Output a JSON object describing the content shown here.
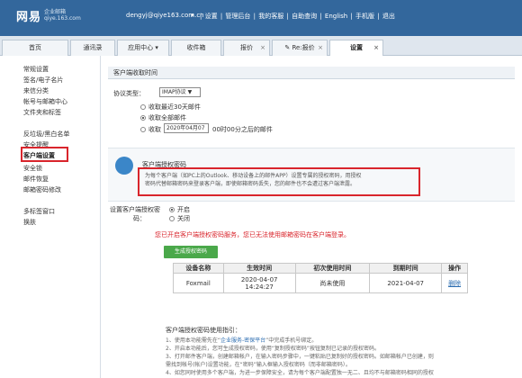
{
  "header": {
    "logo": "网易",
    "logo_sub_line1": "企业邮箱",
    "logo_sub_line2": "qiye.163.com",
    "account": "dengyj@qiye163.com.cn",
    "account_caret": "▾",
    "nav": [
      "设置",
      "管理后台",
      "我的客服",
      "自助查询",
      "English",
      "手机版",
      "退出"
    ]
  },
  "tabs": [
    {
      "label": "首页"
    },
    {
      "label": "通讯录"
    },
    {
      "label": "应用中心",
      "suffix": "▾"
    },
    {
      "label": "收件箱"
    },
    {
      "label": "报价",
      "suffix": "×"
    },
    {
      "label": "Re:报价",
      "suffix": "×"
    },
    {
      "label": "设置",
      "suffix": "×"
    }
  ],
  "sidebar": {
    "items": [
      "常规设置",
      "签名/电子名片",
      "来信分类",
      "帐号与邮箱中心",
      "文件夹和标签",
      "反垃圾/黑白名单",
      "安全提醒",
      "客户端设置",
      "安全锁",
      "邮件恢复",
      "邮箱密码修改",
      "多标签窗口",
      "换肤"
    ],
    "selected": "客户端设置"
  },
  "client_section": {
    "title": "客户端收取时间",
    "protocol_label": "协议类型：",
    "protocol_value": "IMAP协议",
    "protocol_caret": "▼",
    "opt_recent": "收取最近30天邮件",
    "opt_all": "收取全部邮件",
    "opt_since_prefix": "收取",
    "opt_since_date": "2020年04月07",
    "opt_since_suffix": "00时00分之后的邮件"
  },
  "auth_section": {
    "title": "客户端授权密码",
    "desc_line1": "为每个客户端（如PC上的Outlook、移动设备上的邮件APP）设置专属的授权密码，用授权",
    "desc_line2": "密码代替邮箱密码来登录客户端，即使邮箱密码丢失，您的邮件也不会遭过客户端泄露。",
    "setting_label_1": "设置客户端授权密",
    "setting_label_2": "码：",
    "on": "开启",
    "off": "关闭",
    "warning": "您已开启客户端授权密码服务，您已无法使用邮箱密码在客户端登录。",
    "generate_btn": "生成授权密码"
  },
  "table": {
    "headers": [
      "设备名称",
      "生效时间",
      "初次使用时间",
      "到期时间",
      "操作"
    ],
    "rows": [
      {
        "device": "Foxmail",
        "effective_1": "2020-04-07",
        "effective_2": "14:24:27",
        "first_use": "尚未使用",
        "expire": "2021-04-07",
        "action": "删除"
      }
    ]
  },
  "guide": {
    "title": "客户端授权密码使用指引：",
    "l1_pre": "1、使用本功能需先在“",
    "l1_link": "企业服务-密保平台",
    "l1_post": "”中完成手机号绑定。",
    "l2": "2、开启本功能后，您可生成授权密码，使用“复制授权密码”按钮复制已记录的授权密码。",
    "l3": "3、打开邮件客户端，创建邮箱帐户，在输入密码步骤中，一键粘贴已复制好的授权密码。如邮箱帐户已创建，则",
    "l4": "需找到帐号(帐户)设置功能，在“密码”输入框输入授权密码（而非邮箱密码）。",
    "l5": "4、如您同时使用多个客户端，为进一步保障安全，请为每个客户端配置独一无二、且均不与邮箱密码相同的授权"
  }
}
